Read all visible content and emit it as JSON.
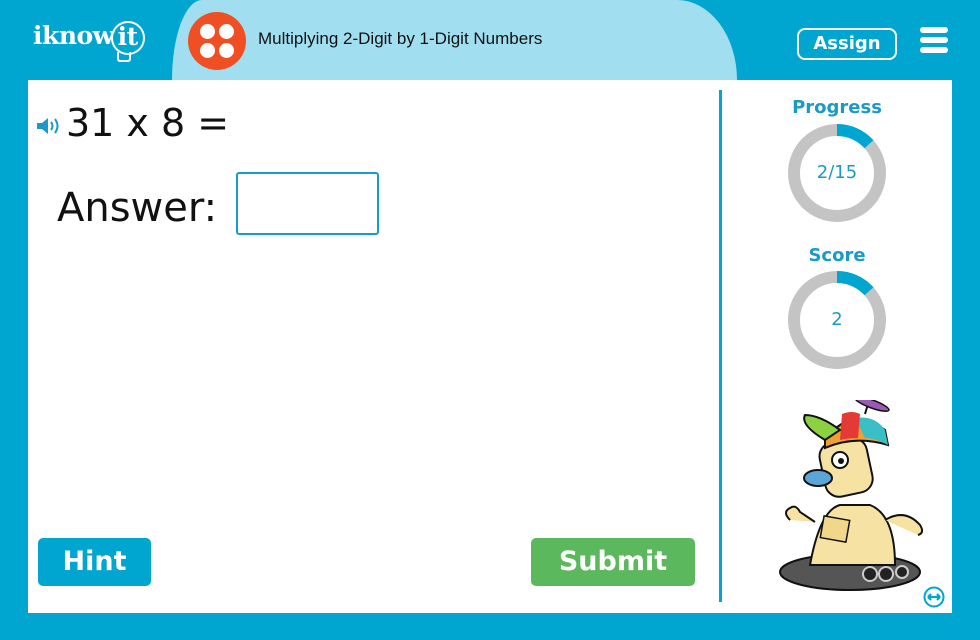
{
  "header": {
    "logo_text": "iknow",
    "logo_bulb_text": "it",
    "title": "Multiplying 2-Digit by 1-Digit Numbers",
    "assign_label": "Assign",
    "menu_icon": "hamburger-menu-icon",
    "topic_icon": "four-dots-icon"
  },
  "question": {
    "speaker_icon": "speaker-icon",
    "text": "31 x 8 =",
    "answer_label": "Answer:",
    "answer_value": "",
    "answer_placeholder": ""
  },
  "buttons": {
    "hint_label": "Hint",
    "submit_label": "Submit"
  },
  "sidebar": {
    "progress": {
      "label": "Progress",
      "text": "2/15",
      "current": 2,
      "total": 15
    },
    "score": {
      "label": "Score",
      "text": "2",
      "fraction": 0.1333
    },
    "mascot": "robot-mascot",
    "resize_icon": "resize-arrows-icon"
  },
  "colors": {
    "brand_blue": "#00a6cf",
    "pill_light_blue": "#a1dff0",
    "topic_orange": "#f04e23",
    "submit_green": "#5cb85c",
    "ring_gray": "#c4c4c4",
    "text_blue": "#1a9ac7"
  }
}
